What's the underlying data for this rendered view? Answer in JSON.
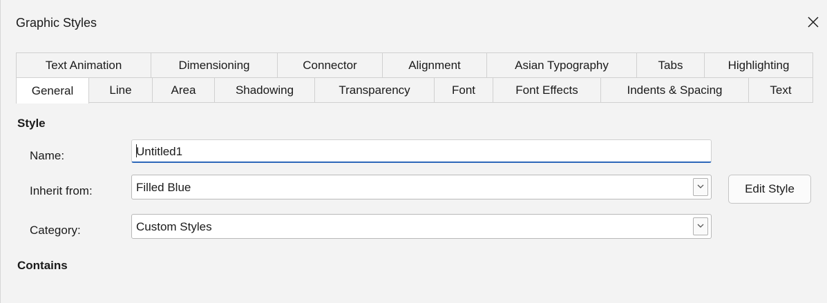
{
  "window": {
    "title": "Graphic Styles",
    "close_icon": "close-icon"
  },
  "tabs": {
    "back_row": [
      {
        "label": "Text Animation"
      },
      {
        "label": "Dimensioning"
      },
      {
        "label": "Connector"
      },
      {
        "label": "Alignment"
      },
      {
        "label": "Asian Typography"
      },
      {
        "label": "Tabs"
      },
      {
        "label": "Highlighting"
      }
    ],
    "front_row": [
      {
        "label": "General",
        "active": true
      },
      {
        "label": "Line"
      },
      {
        "label": "Area"
      },
      {
        "label": "Shadowing"
      },
      {
        "label": "Transparency"
      },
      {
        "label": "Font"
      },
      {
        "label": "Font Effects"
      },
      {
        "label": "Indents & Spacing"
      },
      {
        "label": "Text"
      }
    ]
  },
  "style_section": {
    "heading": "Style",
    "name_label": "Name:",
    "name_value": "Untitled1",
    "inherit_label": "Inherit from:",
    "inherit_value": "Filled Blue",
    "category_label": "Category:",
    "category_value": "Custom Styles",
    "edit_style_label": "Edit Style",
    "dropdown_icon": "chevron-down-icon"
  },
  "contains_section": {
    "heading": "Contains"
  },
  "colors": {
    "background": "#f3f3f3",
    "field_background": "#ffffff",
    "focus_underline": "#2a66b8",
    "border": "#d0d0d0"
  }
}
